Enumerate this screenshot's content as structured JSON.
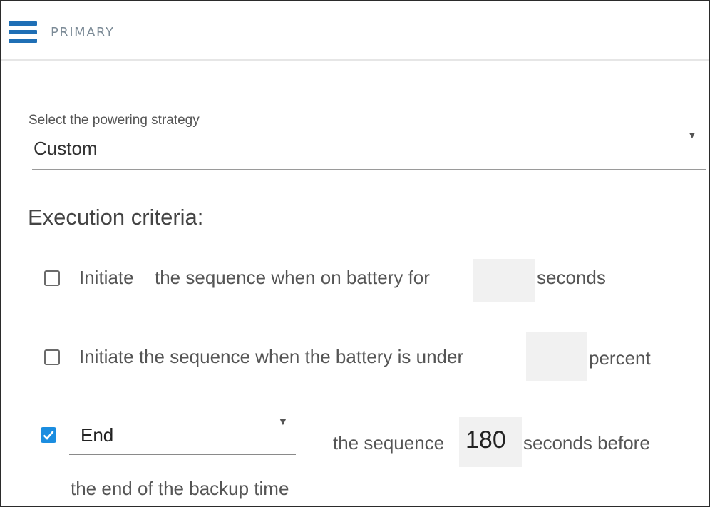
{
  "header": {
    "icon": "menu-icon",
    "title": "PRIMARY"
  },
  "strategy": {
    "label": "Select the powering strategy",
    "value": "Custom"
  },
  "execution": {
    "title": "Execution criteria:",
    "criteria1": {
      "checked": false,
      "text_initiate": "Initiate",
      "text_before": "the sequence when on battery for",
      "value": "",
      "text_after": "seconds"
    },
    "criteria2": {
      "checked": false,
      "text_before": "Initiate the sequence when the battery is under",
      "value": "",
      "text_after": "percent"
    },
    "criteria3": {
      "checked": true,
      "select_value": "End",
      "text_before": "the sequence",
      "value": "180",
      "text_after": "seconds before",
      "text_line2": "the end of the backup time"
    }
  },
  "colors": {
    "accent": "#1b8de0",
    "menu_icon": "#1f6fb5"
  }
}
